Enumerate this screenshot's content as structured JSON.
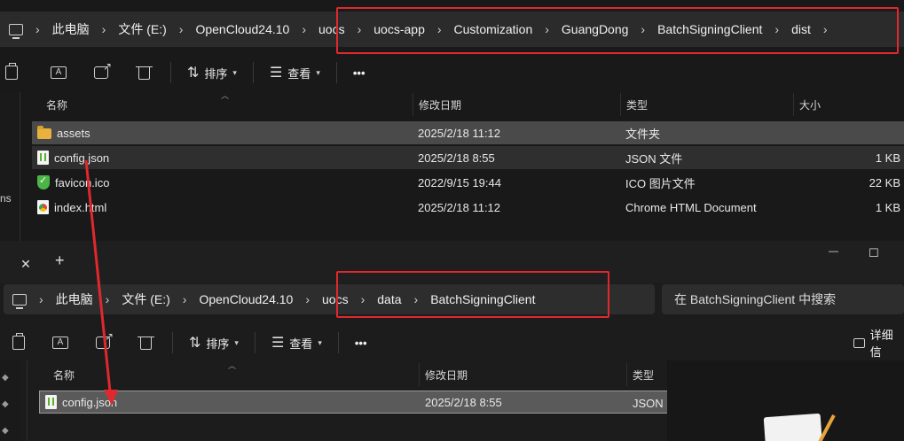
{
  "window1": {
    "breadcrumb": [
      "此电脑",
      "文件 (E:)",
      "OpenCloud24.10",
      "uocs",
      "uocs-app",
      "Customization",
      "GuangDong",
      "BatchSigningClient",
      "dist"
    ],
    "toolbar": {
      "sort_label": "排序",
      "view_label": "查看",
      "more_label": "•••"
    },
    "columns": {
      "name": "名称",
      "modified": "修改日期",
      "type": "类型",
      "size": "大小"
    },
    "files": [
      {
        "name": "assets",
        "modified": "2025/2/18 11:12",
        "type": "文件夹",
        "size": "",
        "icon": "folder-icon"
      },
      {
        "name": "config.json",
        "modified": "2025/2/18 8:55",
        "type": "JSON 文件",
        "size": "1 KB",
        "icon": "json-file-icon"
      },
      {
        "name": "favicon.ico",
        "modified": "2022/9/15 19:44",
        "type": "ICO 图片文件",
        "size": "22 KB",
        "icon": "ico-file-icon"
      },
      {
        "name": "index.html",
        "modified": "2025/2/18 11:12",
        "type": "Chrome HTML Document",
        "size": "1 KB",
        "icon": "html-file-icon"
      }
    ],
    "side_label": "ns"
  },
  "window2": {
    "tab_close": "✕",
    "tab_add": "+",
    "minimize": "—",
    "maximize": "☐",
    "breadcrumb": [
      "此电脑",
      "文件 (E:)",
      "OpenCloud24.10",
      "uocs",
      "data",
      "BatchSigningClient"
    ],
    "search_placeholder": "在 BatchSigningClient 中搜索",
    "toolbar": {
      "sort_label": "排序",
      "view_label": "查看",
      "more_label": "•••",
      "details_label": "详细信"
    },
    "columns": {
      "name": "名称",
      "modified": "修改日期",
      "type": "类型"
    },
    "files": [
      {
        "name": "config.json",
        "modified": "2025/2/18 8:55",
        "type": "JSON 文",
        "icon": "json-file-icon"
      }
    ]
  },
  "colors": {
    "annotation_red": "#e0282e",
    "selection": "#4a4a4a",
    "folder": "#e9b13e"
  }
}
